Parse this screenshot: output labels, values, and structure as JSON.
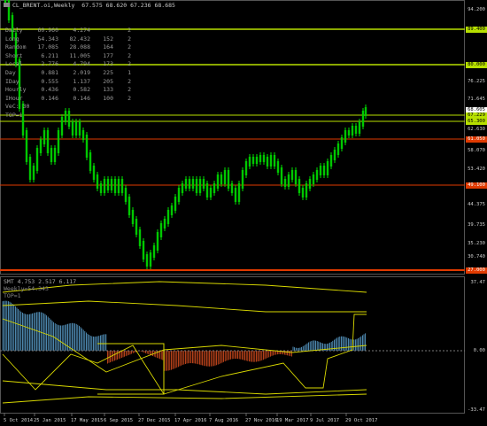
{
  "header": {
    "title": "CL_BRENT.oi,Weekly",
    "ohlc": "67.575 68.620 67.236 68.685"
  },
  "stats": {
    "rows": [
      {
        "name": "Daily",
        "v1": "60.960",
        "v2": "4.274",
        "v3": "",
        "v4": "2"
      },
      {
        "name": "Long",
        "v1": "54.343",
        "v2": "82.432",
        "v3": "152",
        "v4": "2"
      },
      {
        "name": "Random",
        "v1": "17.085",
        "v2": "28.088",
        "v3": "164",
        "v4": "2"
      },
      {
        "name": "Short",
        "v1": "6.211",
        "v2": "11.005",
        "v3": "177",
        "v4": "2"
      },
      {
        "name": "Local",
        "v1": "2.776",
        "v2": "4.794",
        "v3": "173",
        "v4": "2"
      },
      {
        "name": "Day",
        "v1": "0.881",
        "v2": "2.019",
        "v3": "225",
        "v4": "1"
      },
      {
        "name": "IDay",
        "v1": "0.555",
        "v2": "1.137",
        "v3": "205",
        "v4": "2"
      },
      {
        "name": "Hourly",
        "v1": "0.436",
        "v2": "0.582",
        "v3": "133",
        "v4": "2"
      },
      {
        "name": "IHour",
        "v1": "0.146",
        "v2": "0.146",
        "v3": "100",
        "v4": "2"
      }
    ],
    "note1": "VeC: 30",
    "note2": "TOP=1"
  },
  "price_axis": {
    "ticks": [
      "94.200",
      "89.400",
      "80.000",
      "81.035",
      "76.225",
      "71.645",
      "67.229",
      "62.630",
      "58.070",
      "53.420",
      "48.865",
      "44.375",
      "39.735",
      "35.230",
      "30.740"
    ],
    "tags": [
      {
        "text": "89.400",
        "color": "#b7e000",
        "text_color": "#000"
      },
      {
        "text": "80.000",
        "color": "#b7e000",
        "text_color": "#000"
      },
      {
        "text": "68.605",
        "color": "#ffffff",
        "text_color": "#000"
      },
      {
        "text": "67.229",
        "color": "#b7e000",
        "text_color": "#000"
      },
      {
        "text": "65.300",
        "color": "#b7e000",
        "text_color": "#000"
      },
      {
        "text": "61.050",
        "color": "#e03a00",
        "text_color": "#fff"
      },
      {
        "text": "49.100",
        "color": "#e03a00",
        "text_color": "#fff"
      },
      {
        "text": "27.000",
        "color": "#e03a00",
        "text_color": "#fff"
      }
    ]
  },
  "indicator": {
    "label": "SMT 4.753 2.517 6.117",
    "sub1": "Weekly=54.343",
    "sub2": "TOP=1",
    "ticks": [
      "37.47",
      "0.00",
      "-33.47"
    ]
  },
  "time_axis": [
    "5 Oct 2014",
    "25 Jan 2015",
    "17 May 2015",
    "6 Sep 2015",
    "27 Dec 2015",
    "17 Apr 2016",
    "7 Aug 2016",
    "27 Nov 2016",
    "19 Mar 2017",
    "9 Jul 2017",
    "29 Oct 2017"
  ],
  "colors": {
    "background": "#000000",
    "candle_up": "#00e000",
    "candle_down": "#00e000",
    "level_green": "#b7e000",
    "level_red": "#e03a00",
    "ind_blue": "#5fa8d8",
    "ind_red": "#e05020",
    "ind_yellow": "#d8d800"
  }
}
